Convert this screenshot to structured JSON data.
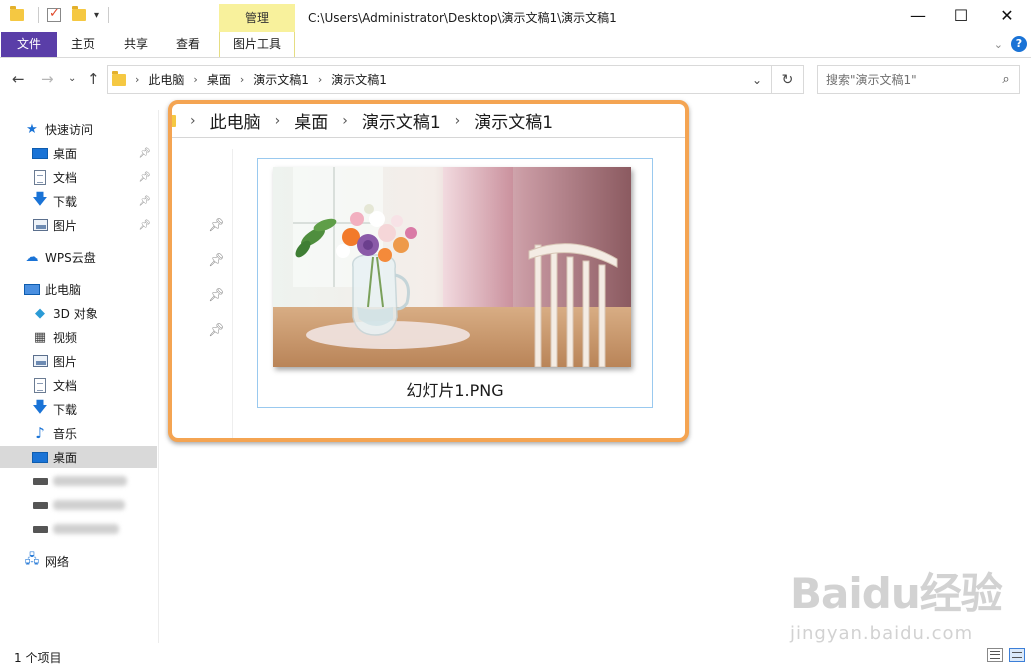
{
  "titlebar": {
    "context_group": "管理",
    "path": "C:\\Users\\Administrator\\Desktop\\演示文稿1\\演示文稿1",
    "minimize": "—",
    "maximize": "☐",
    "close": "✕"
  },
  "ribbon": {
    "tabs": [
      "文件",
      "主页",
      "共享",
      "查看",
      "图片工具"
    ]
  },
  "address": {
    "crumbs": [
      "此电脑",
      "桌面",
      "演示文稿1",
      "演示文稿1"
    ],
    "search_placeholder": "搜索\"演示文稿1\""
  },
  "sidebar": {
    "quick_access": "快速访问",
    "quick_items": [
      "桌面",
      "文档",
      "下载",
      "图片"
    ],
    "wps": "WPS云盘",
    "this_pc": "此电脑",
    "pc_items": [
      "3D 对象",
      "视频",
      "图片",
      "文档",
      "下载",
      "音乐",
      "桌面"
    ],
    "network": "网络",
    "selected": "桌面"
  },
  "panel": {
    "crumbs": [
      "此电脑",
      "桌面",
      "演示文稿1",
      "演示文稿1"
    ],
    "file_name": "幻灯片1.PNG"
  },
  "status": {
    "count": "1 个项目"
  },
  "watermark": {
    "logo": "Baidu经验",
    "sub": "jingyan.baidu.com"
  },
  "icons": {
    "back": "arrow-left-icon",
    "forward": "arrow-right-icon",
    "up": "arrow-up-icon",
    "refresh": "refresh-icon",
    "search": "search-icon"
  },
  "colors": {
    "file_tab": "#5a3ea8",
    "context_tab": "#f8f19c",
    "highlight_border": "#f4a452",
    "selection": "#d9d9d9"
  }
}
